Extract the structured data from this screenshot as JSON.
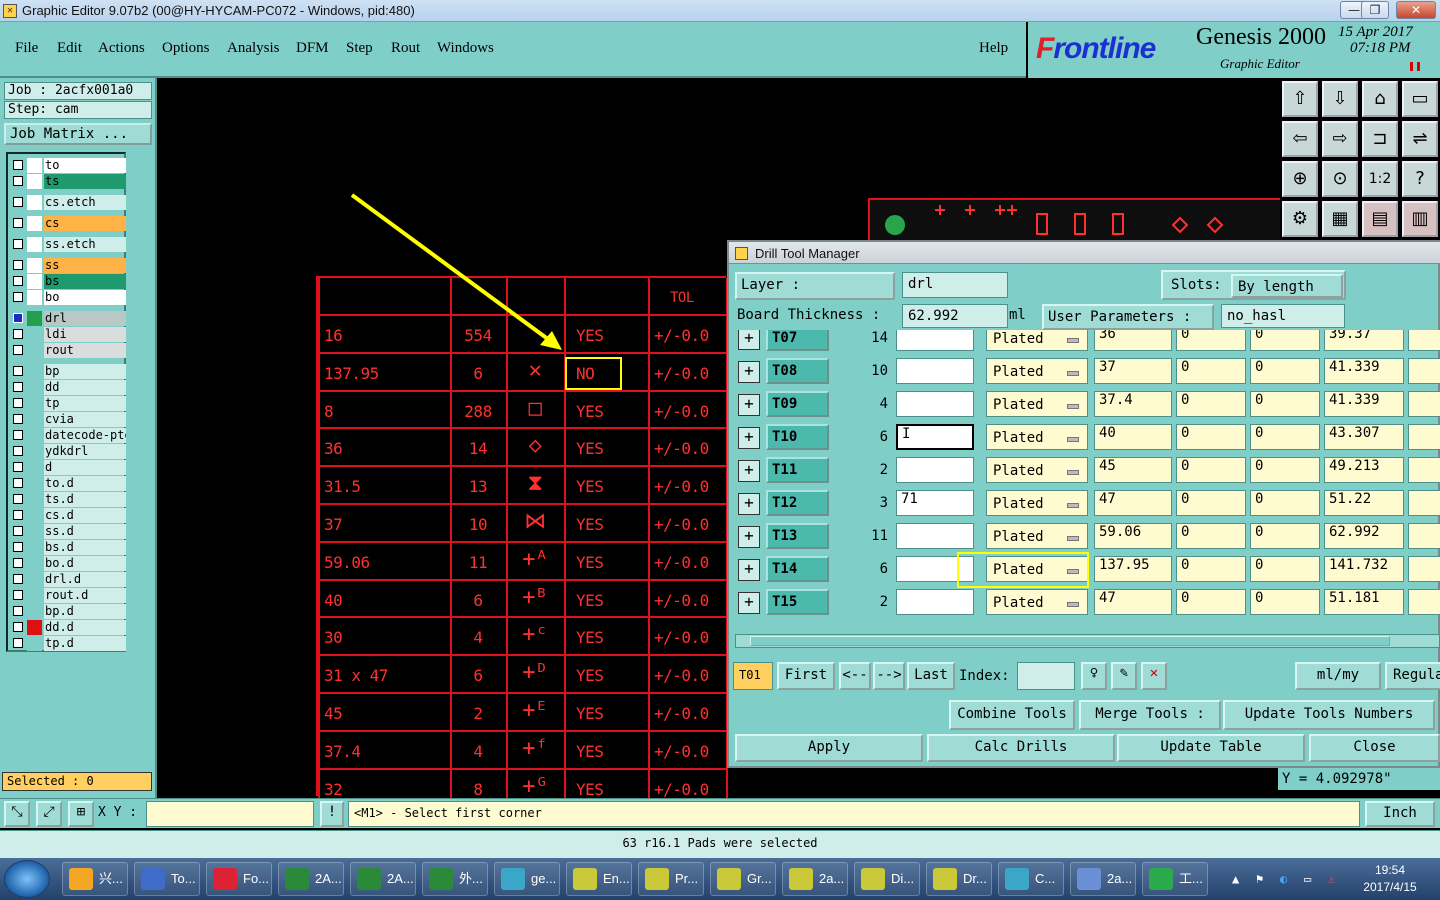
{
  "window": {
    "title": "Graphic Editor 9.07b2 (00@HY-HYCAM-PC072 - Windows, pid:480)",
    "min": "—",
    "max": "❐",
    "close": "✕"
  },
  "menu": {
    "items": [
      "File",
      "Edit",
      "Actions",
      "Options",
      "Analysis",
      "DFM",
      "Step",
      "Rout",
      "Windows"
    ],
    "help": "Help"
  },
  "brand": {
    "logo_prefix": "F",
    "logo": "rontline",
    "product": "Genesis 2000",
    "subtitle": "Graphic Editor",
    "date": "15 Apr 2017",
    "time": "07:18 PM"
  },
  "job": {
    "job": "Job : 2acfx001a0",
    "step": "Step: cam",
    "matrix_btn": "Job Matrix ..."
  },
  "layers": [
    {
      "name": "to",
      "color": "#ffffff",
      "bg": "#ffffff",
      "icon": "▸"
    },
    {
      "name": "ts",
      "color": "#ffffff",
      "bg": "#1f9a6e",
      "icon": ""
    },
    {
      "name": "cs.etch",
      "color": "#ffffff",
      "bg": "#cfeeea",
      "icon": ""
    },
    {
      "name": "cs",
      "color": "#ffffff",
      "bg": "#ffb347",
      "icon": "▸"
    },
    {
      "name": "ss.etch",
      "color": "#ffffff",
      "bg": "#cfeeea",
      "icon": ""
    },
    {
      "name": "ss",
      "color": "#ffffff",
      "bg": "#ffb347",
      "icon": "▸"
    },
    {
      "name": "bs",
      "color": "#ffffff",
      "bg": "#1f9a6e",
      "icon": ""
    },
    {
      "name": "bo",
      "color": "#ffffff",
      "bg": "#ffffff",
      "icon": ""
    },
    {
      "name": "drl",
      "color": "#22a04a",
      "bg": "#b9c7c5",
      "icon": "▪"
    },
    {
      "name": "ldi",
      "color": "#7fcfc8",
      "bg": "#d9dddc",
      "icon": ""
    },
    {
      "name": "rout",
      "color": "#7fcfc8",
      "bg": "#d9dddc",
      "icon": ""
    },
    {
      "name": "bp",
      "color": "#7fcfc8",
      "bg": "#cfeeea",
      "icon": ""
    },
    {
      "name": "dd",
      "color": "#7fcfc8",
      "bg": "#cfeeea",
      "icon": ""
    },
    {
      "name": "tp",
      "color": "#7fcfc8",
      "bg": "#cfeeea",
      "icon": ""
    },
    {
      "name": "cvia",
      "color": "#7fcfc8",
      "bg": "#cfeeea",
      "icon": ""
    },
    {
      "name": "datecode-pte",
      "color": "#7fcfc8",
      "bg": "#cfeeea",
      "icon": ""
    },
    {
      "name": "ydkdrl",
      "color": "#7fcfc8",
      "bg": "#cfeeea",
      "icon": ""
    },
    {
      "name": "d",
      "color": "#7fcfc8",
      "bg": "#cfeeea",
      "icon": ""
    },
    {
      "name": "to.d",
      "color": "#7fcfc8",
      "bg": "#cfeeea",
      "icon": "▸"
    },
    {
      "name": "ts.d",
      "color": "#7fcfc8",
      "bg": "#cfeeea",
      "icon": ""
    },
    {
      "name": "cs.d",
      "color": "#7fcfc8",
      "bg": "#cfeeea",
      "icon": "▸"
    },
    {
      "name": "ss.d",
      "color": "#7fcfc8",
      "bg": "#cfeeea",
      "icon": "▸"
    },
    {
      "name": "bs.d",
      "color": "#7fcfc8",
      "bg": "#cfeeea",
      "icon": ""
    },
    {
      "name": "bo.d",
      "color": "#7fcfc8",
      "bg": "#cfeeea",
      "icon": ""
    },
    {
      "name": "drl.d",
      "color": "#7fcfc8",
      "bg": "#cfeeea",
      "icon": ""
    },
    {
      "name": "rout.d",
      "color": "#7fcfc8",
      "bg": "#cfeeea",
      "icon": ""
    },
    {
      "name": "bp.d",
      "color": "#7fcfc8",
      "bg": "#cfeeea",
      "icon": ""
    },
    {
      "name": "dd.d",
      "color": "#e01010",
      "bg": "#cfeeea",
      "icon": ""
    },
    {
      "name": "tp.d",
      "color": "#7fcfc8",
      "bg": "#cfeeea",
      "icon": ""
    }
  ],
  "selected": "Selected : 0",
  "redtable": {
    "header_tol": "TOL",
    "rows": [
      {
        "size": "16",
        "qty": "554",
        "sym": "",
        "plated": "YES",
        "tol": "+/-0.0"
      },
      {
        "size": "137.95",
        "qty": "6",
        "sym": "✕",
        "plated": "NO",
        "tol": "+/-0.0"
      },
      {
        "size": "8",
        "qty": "288",
        "sym": "□",
        "plated": "YES",
        "tol": "+/-0.0"
      },
      {
        "size": "36",
        "qty": "14",
        "sym": "◇",
        "plated": "YES",
        "tol": "+/-0.0"
      },
      {
        "size": "31.5",
        "qty": "13",
        "sym": "⧗",
        "plated": "YES",
        "tol": "+/-0.0"
      },
      {
        "size": "37",
        "qty": "10",
        "sym": "⋈",
        "plated": "YES",
        "tol": "+/-0.0"
      },
      {
        "size": "59.06",
        "qty": "11",
        "sym": "+ᴬ",
        "plated": "YES",
        "tol": "+/-0.0"
      },
      {
        "size": "40",
        "qty": "6",
        "sym": "+ᴮ",
        "plated": "YES",
        "tol": "+/-0.0"
      },
      {
        "size": "30",
        "qty": "4",
        "sym": "+ᶜ",
        "plated": "YES",
        "tol": "+/-0.0"
      },
      {
        "size": "31 x 47",
        "qty": "6",
        "sym": "+ᴰ",
        "plated": "YES",
        "tol": "+/-0.0"
      },
      {
        "size": "45",
        "qty": "2",
        "sym": "+ᴱ",
        "plated": "YES",
        "tol": "+/-0.0"
      },
      {
        "size": "37.4",
        "qty": "4",
        "sym": "+ᶠ",
        "plated": "YES",
        "tol": "+/-0.0"
      },
      {
        "size": "32",
        "qty": "8",
        "sym": "+ᴳ",
        "plated": "YES",
        "tol": "+/-0.0"
      }
    ]
  },
  "drill": {
    "title": "Drill Tool Manager",
    "layer_label": "Layer :",
    "layer_value": "drl",
    "slots_label": "Slots:",
    "slots_value": "By length",
    "thick_label": "Board Thickness :",
    "thick_value": "62.992",
    "thick_unit": "ml",
    "userparams_label": "User Parameters :",
    "userparams_value": "no_hasl",
    "rows": [
      {
        "tool": "T07",
        "qty": "14",
        "c1": "",
        "type": "Plated",
        "v1": "36",
        "v2": "0",
        "v3": "0",
        "v4": "39.37"
      },
      {
        "tool": "T08",
        "qty": "10",
        "c1": "",
        "type": "Plated",
        "v1": "37",
        "v2": "0",
        "v3": "0",
        "v4": "41.339"
      },
      {
        "tool": "T09",
        "qty": "4",
        "c1": "",
        "type": "Plated",
        "v1": "37.4",
        "v2": "0",
        "v3": "0",
        "v4": "41.339"
      },
      {
        "tool": "T10",
        "qty": "6",
        "c1": "I",
        "type": "Plated",
        "v1": "40",
        "v2": "0",
        "v3": "0",
        "v4": "43.307"
      },
      {
        "tool": "T11",
        "qty": "2",
        "c1": "",
        "type": "Plated",
        "v1": "45",
        "v2": "0",
        "v3": "0",
        "v4": "49.213"
      },
      {
        "tool": "T12",
        "qty": "3",
        "c1": "71",
        "type": "Plated",
        "v1": "47",
        "v2": "0",
        "v3": "0",
        "v4": "51.22"
      },
      {
        "tool": "T13",
        "qty": "11",
        "c1": "",
        "type": "Plated",
        "v1": "59.06",
        "v2": "0",
        "v3": "0",
        "v4": "62.992"
      },
      {
        "tool": "T14",
        "qty": "6",
        "c1": "",
        "type": "Plated",
        "v1": "137.95",
        "v2": "0",
        "v3": "0",
        "v4": "141.732"
      },
      {
        "tool": "T15",
        "qty": "2",
        "c1": "",
        "type": "Plated",
        "v1": "47",
        "v2": "0",
        "v3": "0",
        "v4": "51.181"
      }
    ],
    "cur_tool": "T01",
    "first": "First",
    "prev": "<--",
    "next": "-->",
    "last": "Last",
    "index_label": "Index:",
    "units": "ml/my",
    "regular": "Regula",
    "combine": "Combine Tools",
    "merge": "Merge Tools :",
    "update_nums": "Update Tools Numbers",
    "apply": "Apply",
    "calc": "Calc Drills",
    "update_table": "Update Table",
    "close": "Close"
  },
  "coords": {
    "y": "Y = 4.092978\""
  },
  "status": {
    "xy_label": "X Y :",
    "prompt": "<M1> - Select first corner",
    "units": "Inch",
    "message": "63 r16.1 Pads were selected"
  },
  "taskbar": {
    "items": [
      "兴...",
      "To...",
      "Fo...",
      "2A...",
      "2A...",
      "外...",
      "ge...",
      "En...",
      "Pr...",
      "Gr...",
      "2a...",
      "Di...",
      "Dr...",
      "C...",
      "2a...",
      "工..."
    ],
    "clock_time": "19:54",
    "clock_date": "2017/4/15"
  }
}
